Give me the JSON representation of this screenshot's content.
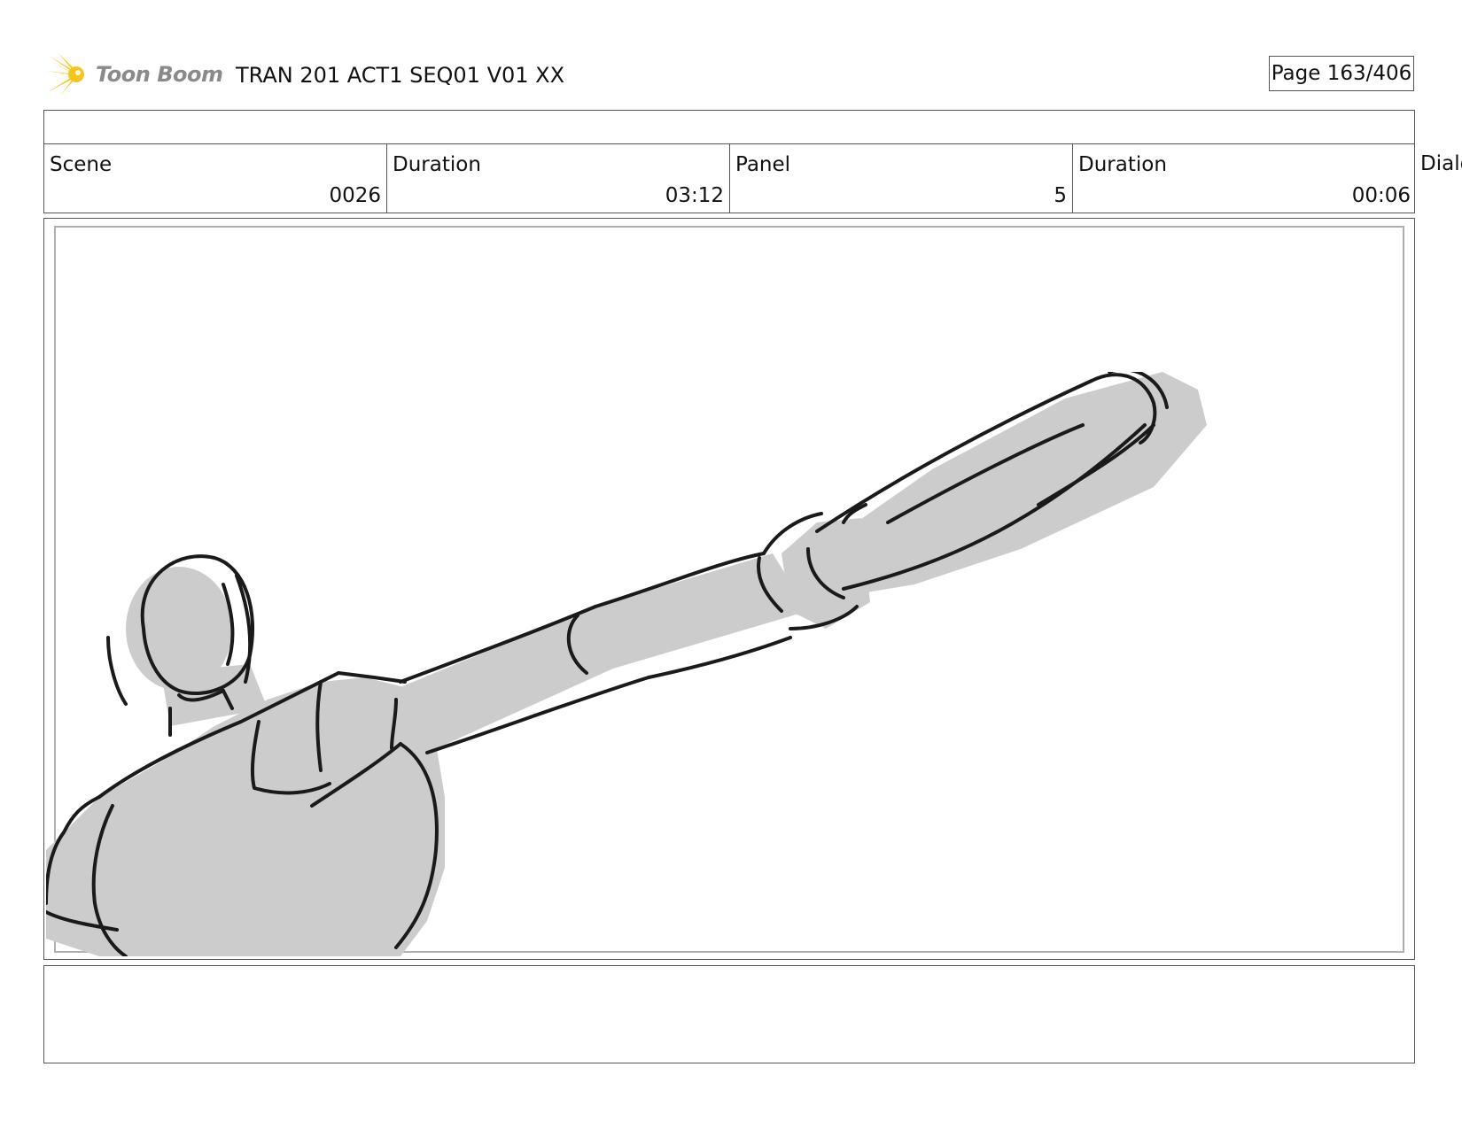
{
  "header": {
    "logo_text": "Toon Boom",
    "logo_icon": "starburst-icon",
    "title": "TRAN 201 ACT1 SEQ01 V01 XX",
    "page_label": "Page 163/406"
  },
  "info": {
    "scene_label": "Scene",
    "scene_value": "0026",
    "scene_duration_label": "Duration",
    "scene_duration_value": "03:12",
    "panel_label": "Panel",
    "panel_value": "5",
    "panel_duration_label": "Duration",
    "panel_duration_value": "00:06",
    "dialog_label_partial": "Dialo"
  },
  "colors": {
    "sketch_fill": "#cccccc",
    "sketch_stroke": "#1a1a1a",
    "logo_yellow": "#f5c518",
    "border": "#555555"
  }
}
